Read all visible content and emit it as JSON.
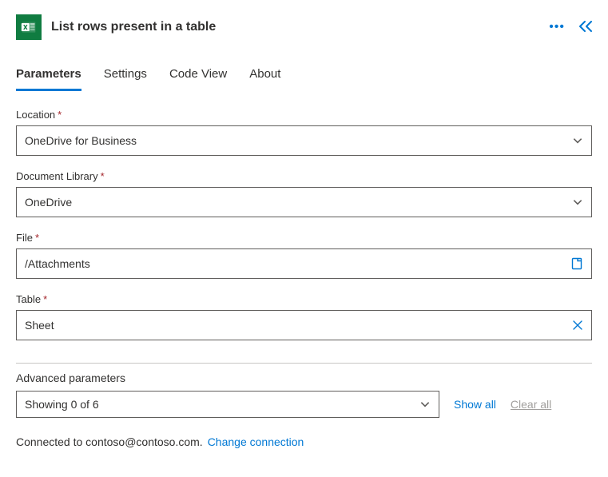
{
  "header": {
    "title": "List rows present in a table"
  },
  "tabs": {
    "parameters": "Parameters",
    "settings": "Settings",
    "codeview": "Code View",
    "about": "About"
  },
  "fields": {
    "location": {
      "label": "Location",
      "value": "OneDrive for Business"
    },
    "library": {
      "label": "Document Library",
      "value": "OneDrive"
    },
    "file": {
      "label": "File",
      "value": "/Attachments"
    },
    "table": {
      "label": "Table",
      "value": "Sheet"
    }
  },
  "advanced": {
    "label": "Advanced parameters",
    "showing": "Showing 0 of 6",
    "show_all": "Show all",
    "clear_all": "Clear all"
  },
  "footer": {
    "connected_prefix": "Connected to ",
    "account": "contoso@contoso.com.",
    "change": "Change connection"
  }
}
